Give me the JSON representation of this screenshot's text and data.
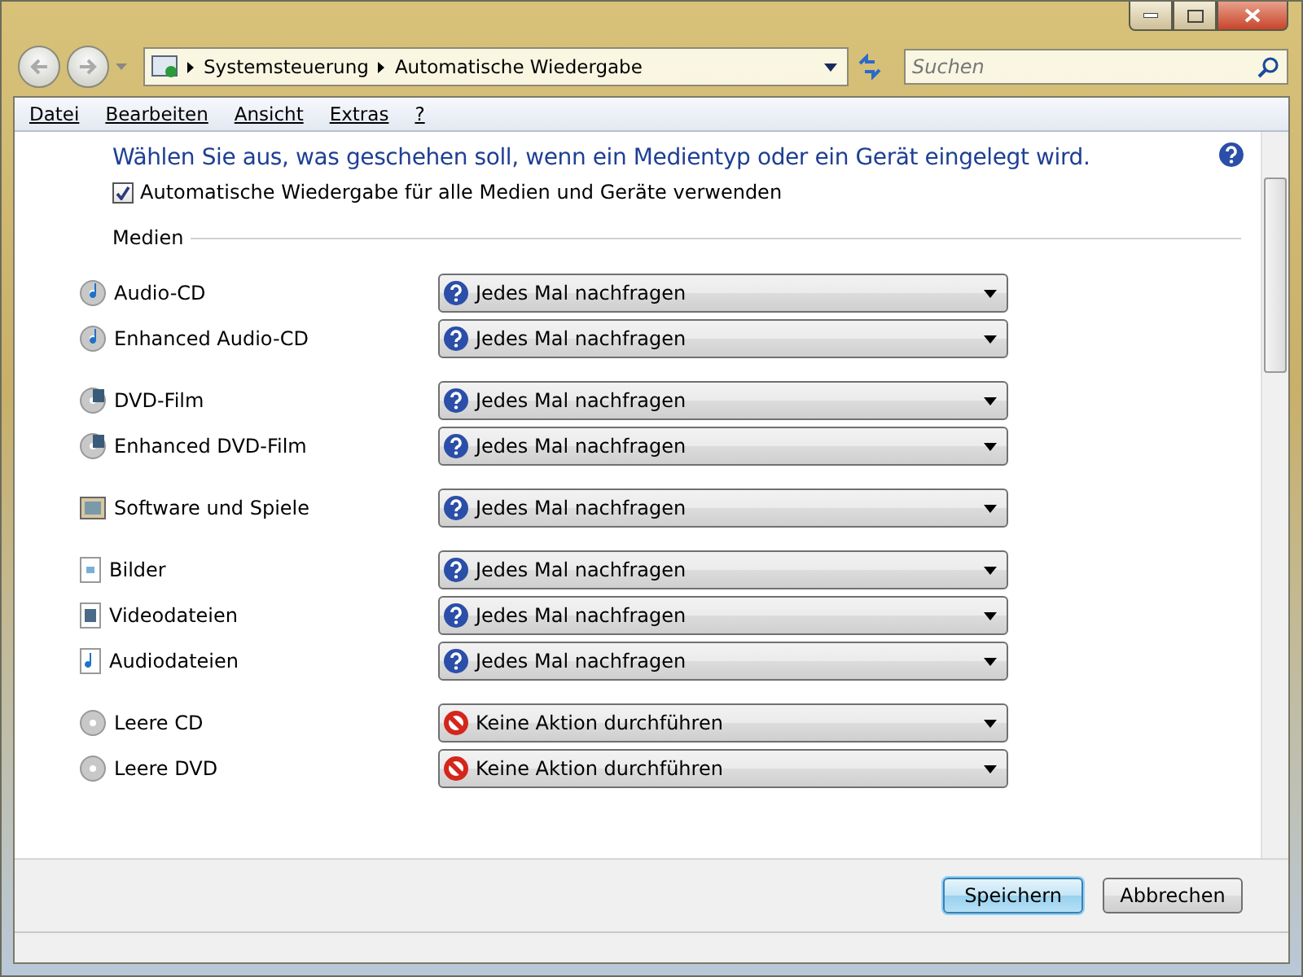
{
  "address_bar": {
    "path": [
      "Systemsteuerung",
      "Automatische Wiedergabe"
    ]
  },
  "search": {
    "placeholder": "Suchen"
  },
  "menu": [
    "Datei",
    "Bearbeiten",
    "Ansicht",
    "Extras",
    "?"
  ],
  "heading": "Wählen Sie aus, was geschehen soll, wenn ein Medientyp oder ein Gerät eingelegt wird.",
  "autoplay_checkbox": {
    "label": "Automatische Wiedergabe für alle Medien und Geräte verwenden",
    "checked": true
  },
  "section": "Medien",
  "groups": [
    [
      {
        "label": "Audio-CD",
        "kind": "audio-cd",
        "action": {
          "kind": "ask",
          "text": "Jedes Mal nachfragen"
        }
      },
      {
        "label": "Enhanced Audio-CD",
        "kind": "audio-cd",
        "action": {
          "kind": "ask",
          "text": "Jedes Mal nachfragen"
        }
      }
    ],
    [
      {
        "label": "DVD-Film",
        "kind": "dvd",
        "action": {
          "kind": "ask",
          "text": "Jedes Mal nachfragen"
        }
      },
      {
        "label": "Enhanced DVD-Film",
        "kind": "dvd",
        "action": {
          "kind": "ask",
          "text": "Jedes Mal nachfragen"
        }
      }
    ],
    [
      {
        "label": "Software und Spiele",
        "kind": "software",
        "action": {
          "kind": "ask",
          "text": "Jedes Mal nachfragen"
        }
      }
    ],
    [
      {
        "label": "Bilder",
        "kind": "picture-file",
        "action": {
          "kind": "ask",
          "text": "Jedes Mal nachfragen"
        }
      },
      {
        "label": "Videodateien",
        "kind": "video-file",
        "action": {
          "kind": "ask",
          "text": "Jedes Mal nachfragen"
        }
      },
      {
        "label": "Audiodateien",
        "kind": "audio-file",
        "action": {
          "kind": "ask",
          "text": "Jedes Mal nachfragen"
        }
      }
    ],
    [
      {
        "label": "Leere CD",
        "kind": "blank-disc",
        "action": {
          "kind": "none",
          "text": "Keine Aktion durchführen"
        }
      },
      {
        "label": "Leere DVD",
        "kind": "blank-disc",
        "action": {
          "kind": "none",
          "text": "Keine Aktion durchführen"
        }
      }
    ]
  ],
  "buttons": [
    {
      "label": "Speichern",
      "default": true
    },
    {
      "label": "Abbrechen",
      "default": false
    }
  ]
}
